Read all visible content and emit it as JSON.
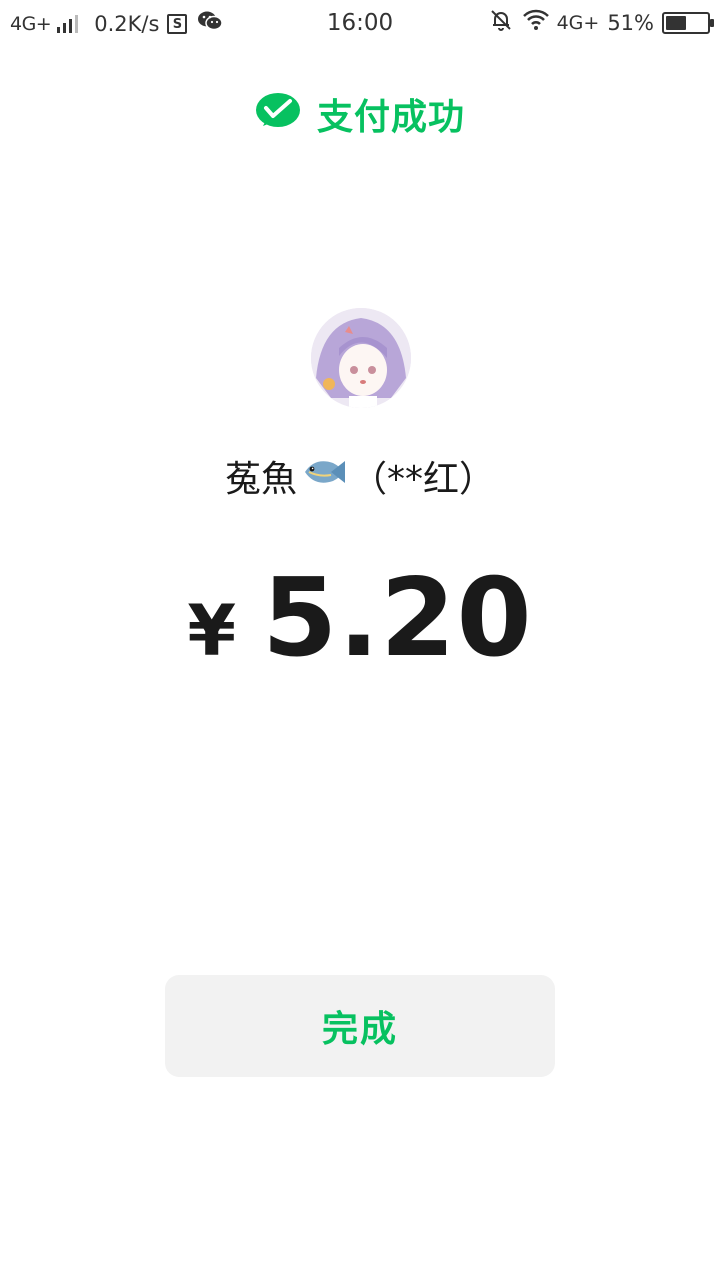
{
  "status_bar": {
    "network_left": "4G+",
    "speed": "0.2K/s",
    "s_icon_letter": "S",
    "time": "16:00",
    "network_right": "4G+",
    "battery_percent": "51%",
    "battery_level": 0.51
  },
  "header": {
    "title": "支付成功",
    "icon": "wechat-pay-check-icon",
    "accent_color": "#07c160"
  },
  "payee": {
    "name_prefix": "菟魚",
    "emoji": "🐟",
    "masked_name": "（**红）"
  },
  "amount": {
    "currency": "¥",
    "value": "5.20"
  },
  "done_button": {
    "label": "完成"
  }
}
